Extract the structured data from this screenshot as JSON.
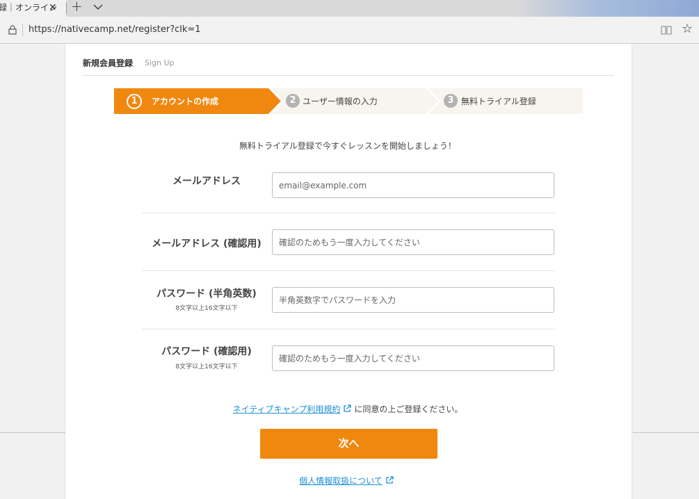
{
  "browser": {
    "tab_title": "録｜オンライン",
    "url": "https://nativecamp.net/register?clk=1"
  },
  "page": {
    "title": "新規会員登録",
    "subtitle": "Sign Up",
    "steps": [
      {
        "num": "1",
        "label": "アカウントの作成",
        "active": true
      },
      {
        "num": "2",
        "label": "ユーザー情報の入力",
        "active": false
      },
      {
        "num": "3",
        "label": "無料トライアル登録",
        "active": false
      }
    ],
    "intro": "無料トライアル登録で今すぐレッスンを開始しましょう！",
    "fields": [
      {
        "label": "メールアドレス",
        "hint": "",
        "placeholder": "email@example.com",
        "value": ""
      },
      {
        "label": "メールアドレス (確認用)",
        "hint": "",
        "placeholder": "確認のためもう一度入力してください",
        "value": ""
      },
      {
        "label": "パスワード (半角英数)",
        "hint": "8文字以上16文字以下",
        "placeholder": "半角英数字でパスワードを入力",
        "value": ""
      },
      {
        "label": "パスワード (確認用)",
        "hint": "8文字以上16文字以下",
        "placeholder": "確認のためもう一度入力してください",
        "value": ""
      }
    ],
    "terms_link": "ネイティブキャンプ利用規約",
    "terms_text": "に同意の上ご登録ください。",
    "next_button": "次へ",
    "privacy_link": "個人情報取扱について"
  },
  "colors": {
    "accent": "#f0880f",
    "link": "#1a8fd6",
    "step_inactive_bg": "#f8f5ee"
  }
}
